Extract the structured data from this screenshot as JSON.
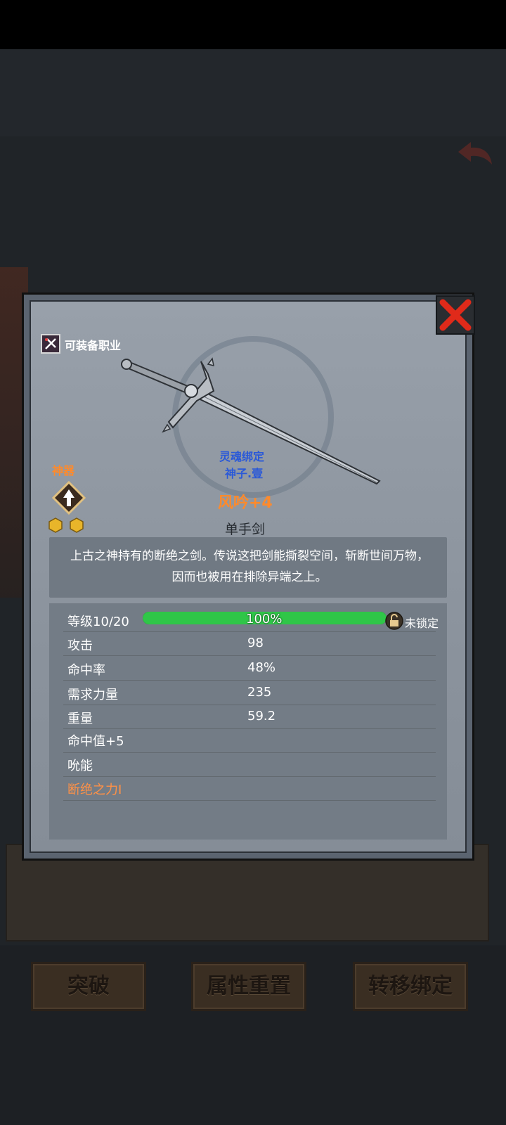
{
  "item": {
    "equippable_class_label": "可装备职业",
    "artifact_label": "神器",
    "soul_bind": "灵魂绑定",
    "bound_to": "神子.壹",
    "name": "风吟+4",
    "type": "单手剑",
    "description": "上古之神持有的断绝之剑。传说这把剑能撕裂空间，斩断世间万物，因而也被用在排除异端之上。",
    "gem_count": 2
  },
  "stats": {
    "level_label": "等级10/20",
    "level_progress": 1.0,
    "level_progress_text": "100%",
    "lock_status": "未锁定",
    "rows": [
      {
        "label": "攻击",
        "value": "98"
      },
      {
        "label": "命中率",
        "value": "48%"
      },
      {
        "label": "需求力量",
        "value": "235"
      },
      {
        "label": "重量",
        "value": "59.2"
      }
    ],
    "bonuses": [
      {
        "label": "命中值+5"
      },
      {
        "label": "吮能"
      },
      {
        "label": "断绝之力I"
      }
    ]
  },
  "buttons": {
    "breakthrough": "突破",
    "reset": "属性重置",
    "transfer": "转移绑定"
  },
  "colors": {
    "orange": "#ff8a2b",
    "blue": "#2a59d8",
    "bar_green": "#2fc648",
    "close_red": "#e02a1a"
  }
}
